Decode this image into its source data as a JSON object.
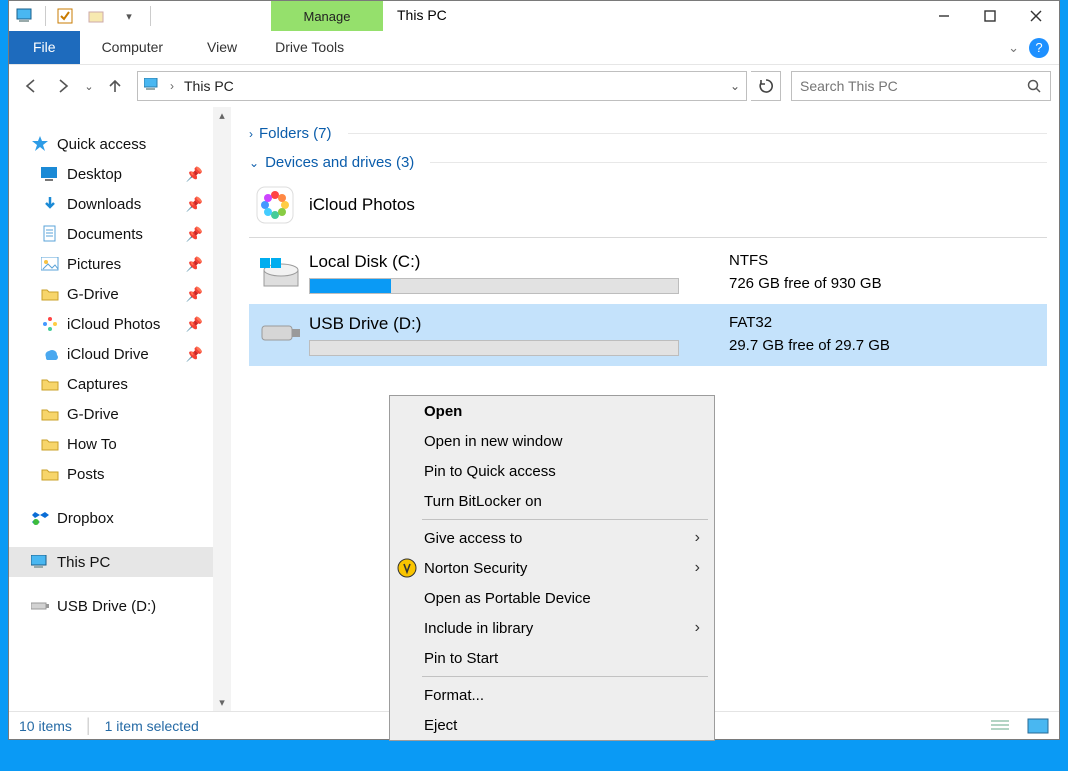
{
  "window": {
    "title_context": "Manage",
    "title": "This PC",
    "tools_tab": "Drive Tools"
  },
  "ribbon": {
    "file": "File",
    "computer": "Computer",
    "view": "View"
  },
  "address": {
    "location": "This PC"
  },
  "search": {
    "placeholder": "Search This PC"
  },
  "sidebar": {
    "quick_access": "Quick access",
    "items": [
      {
        "label": "Desktop",
        "pinned": true
      },
      {
        "label": "Downloads",
        "pinned": true
      },
      {
        "label": "Documents",
        "pinned": true
      },
      {
        "label": "Pictures",
        "pinned": true
      },
      {
        "label": "G-Drive",
        "pinned": true
      },
      {
        "label": "iCloud Photos",
        "pinned": true
      },
      {
        "label": "iCloud Drive",
        "pinned": true
      },
      {
        "label": "Captures",
        "pinned": false
      },
      {
        "label": "G-Drive",
        "pinned": false
      },
      {
        "label": "How To",
        "pinned": false
      },
      {
        "label": "Posts",
        "pinned": false
      }
    ],
    "dropbox": "Dropbox",
    "this_pc": "This PC",
    "usb": "USB Drive (D:)"
  },
  "content": {
    "folders_group": "Folders (7)",
    "devices_group": "Devices and drives (3)",
    "icloud_photos": "iCloud Photos",
    "drives": [
      {
        "name": "Local Disk (C:)",
        "fs": "NTFS",
        "free": "726 GB free of 930 GB",
        "fill_pct": 22
      },
      {
        "name": "USB Drive (D:)",
        "fs": "FAT32",
        "free": "29.7 GB free of 29.7 GB",
        "fill_pct": 0
      }
    ]
  },
  "ctx": {
    "open": "Open",
    "open_new": "Open in new window",
    "pin_qa": "Pin to Quick access",
    "bitlocker": "Turn BitLocker on",
    "give_access": "Give access to",
    "norton": "Norton Security",
    "portable": "Open as Portable Device",
    "include_lib": "Include in library",
    "pin_start": "Pin to Start",
    "format": "Format...",
    "eject": "Eject"
  },
  "status": {
    "count": "10 items",
    "selected": "1 item selected"
  }
}
